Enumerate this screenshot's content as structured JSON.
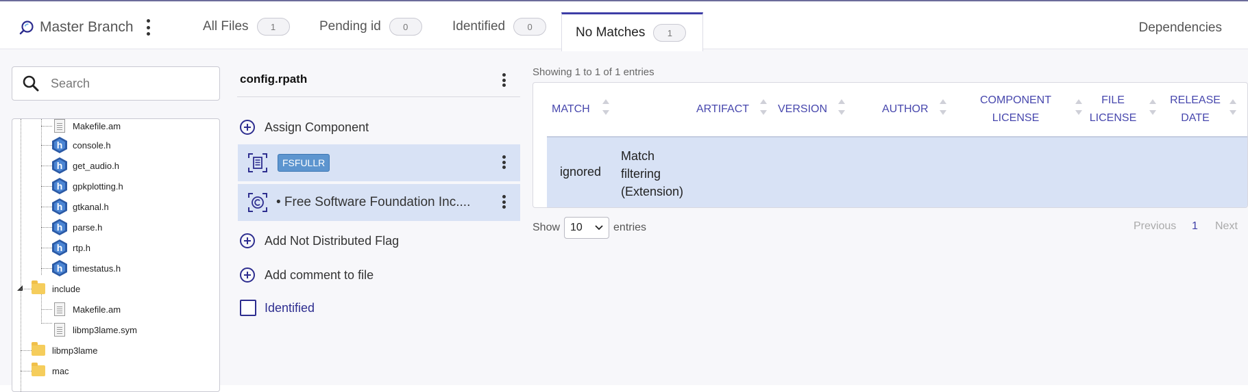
{
  "app": {
    "title": "Master Branch"
  },
  "tabs": [
    {
      "label": "All Files",
      "count": "1"
    },
    {
      "label": "Pending id",
      "count": "0"
    },
    {
      "label": "Identified",
      "count": "0"
    },
    {
      "label": "No Matches",
      "count": "1"
    }
  ],
  "dependencies_label": "Dependencies",
  "search": {
    "placeholder": "Search"
  },
  "tree": [
    {
      "label": "Makefile.am",
      "type": "file"
    },
    {
      "label": "console.h",
      "type": "header"
    },
    {
      "label": "get_audio.h",
      "type": "header"
    },
    {
      "label": "gpkplotting.h",
      "type": "header"
    },
    {
      "label": "gtkanal.h",
      "type": "header"
    },
    {
      "label": "parse.h",
      "type": "header"
    },
    {
      "label": "rtp.h",
      "type": "header"
    },
    {
      "label": "timestatus.h",
      "type": "header"
    },
    {
      "label": "include",
      "type": "folder"
    },
    {
      "label": "Makefile.am",
      "type": "file"
    },
    {
      "label": "libmp3lame.sym",
      "type": "file"
    },
    {
      "label": "libmp3lame",
      "type": "folder"
    },
    {
      "label": "mac",
      "type": "folder"
    }
  ],
  "file": {
    "name": "config.rpath",
    "actions": {
      "assign_component": "Assign Component",
      "add_not_distributed": "Add Not Distributed Flag",
      "add_comment": "Add comment to file",
      "identified": "Identified"
    },
    "license_chip": "FSFULLR",
    "copyright": "• Free Software Foundation Inc...."
  },
  "table": {
    "showing": "Showing 1 to 1 of 1 entries",
    "columns": [
      "MATCH",
      "ARTIFACT",
      "VERSION",
      "AUTHOR",
      "COMPONENT LICENSE",
      "FILE LICENSE",
      "RELEASE DATE"
    ],
    "columns_split": {
      "component_license": [
        "COMPONENT",
        "LICENSE"
      ],
      "file_license": [
        "FILE",
        "LICENSE"
      ],
      "release_date": [
        "RELEASE",
        "DATE"
      ]
    },
    "rows": [
      {
        "match": "ignored",
        "detail": [
          "Match",
          "filtering",
          "(Extension)"
        ]
      }
    ],
    "show_label": "Show",
    "entries_label": "entries",
    "page_size": "10",
    "previous": "Previous",
    "page": "1",
    "next": "Next"
  },
  "colors": {
    "accent": "#3d3da6",
    "selected_row": "#d8e2f5",
    "license_chip": "#5d95cf",
    "folder": "#f5cd5c"
  }
}
